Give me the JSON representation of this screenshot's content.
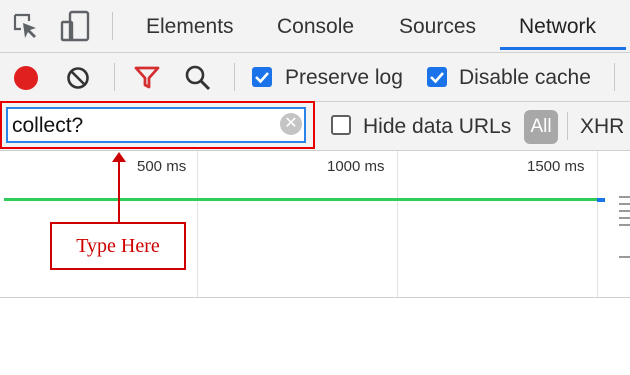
{
  "tabs": [
    {
      "label": "Elements"
    },
    {
      "label": "Console"
    },
    {
      "label": "Sources"
    },
    {
      "label": "Network",
      "active": true
    }
  ],
  "toolbar": {
    "preserve_log": {
      "label": "Preserve log",
      "checked": true
    },
    "disable_cache": {
      "label": "Disable cache",
      "checked": true
    }
  },
  "filter": {
    "value": "collect?",
    "hide_data_urls": {
      "label": "Hide data URLs",
      "checked": false
    },
    "type_all": "All",
    "type_xhr": "XHR"
  },
  "timeline": {
    "ticks": [
      "500 ms",
      "1000 ms",
      "1500 ms"
    ]
  },
  "annotation": {
    "text": "Type Here",
    "color": "#cc0000"
  },
  "colors": {
    "accent": "#1a73e8",
    "record": "#e0201e",
    "filter_icon": "#d32f2f",
    "timeline_bar": "#2fcc5a"
  }
}
